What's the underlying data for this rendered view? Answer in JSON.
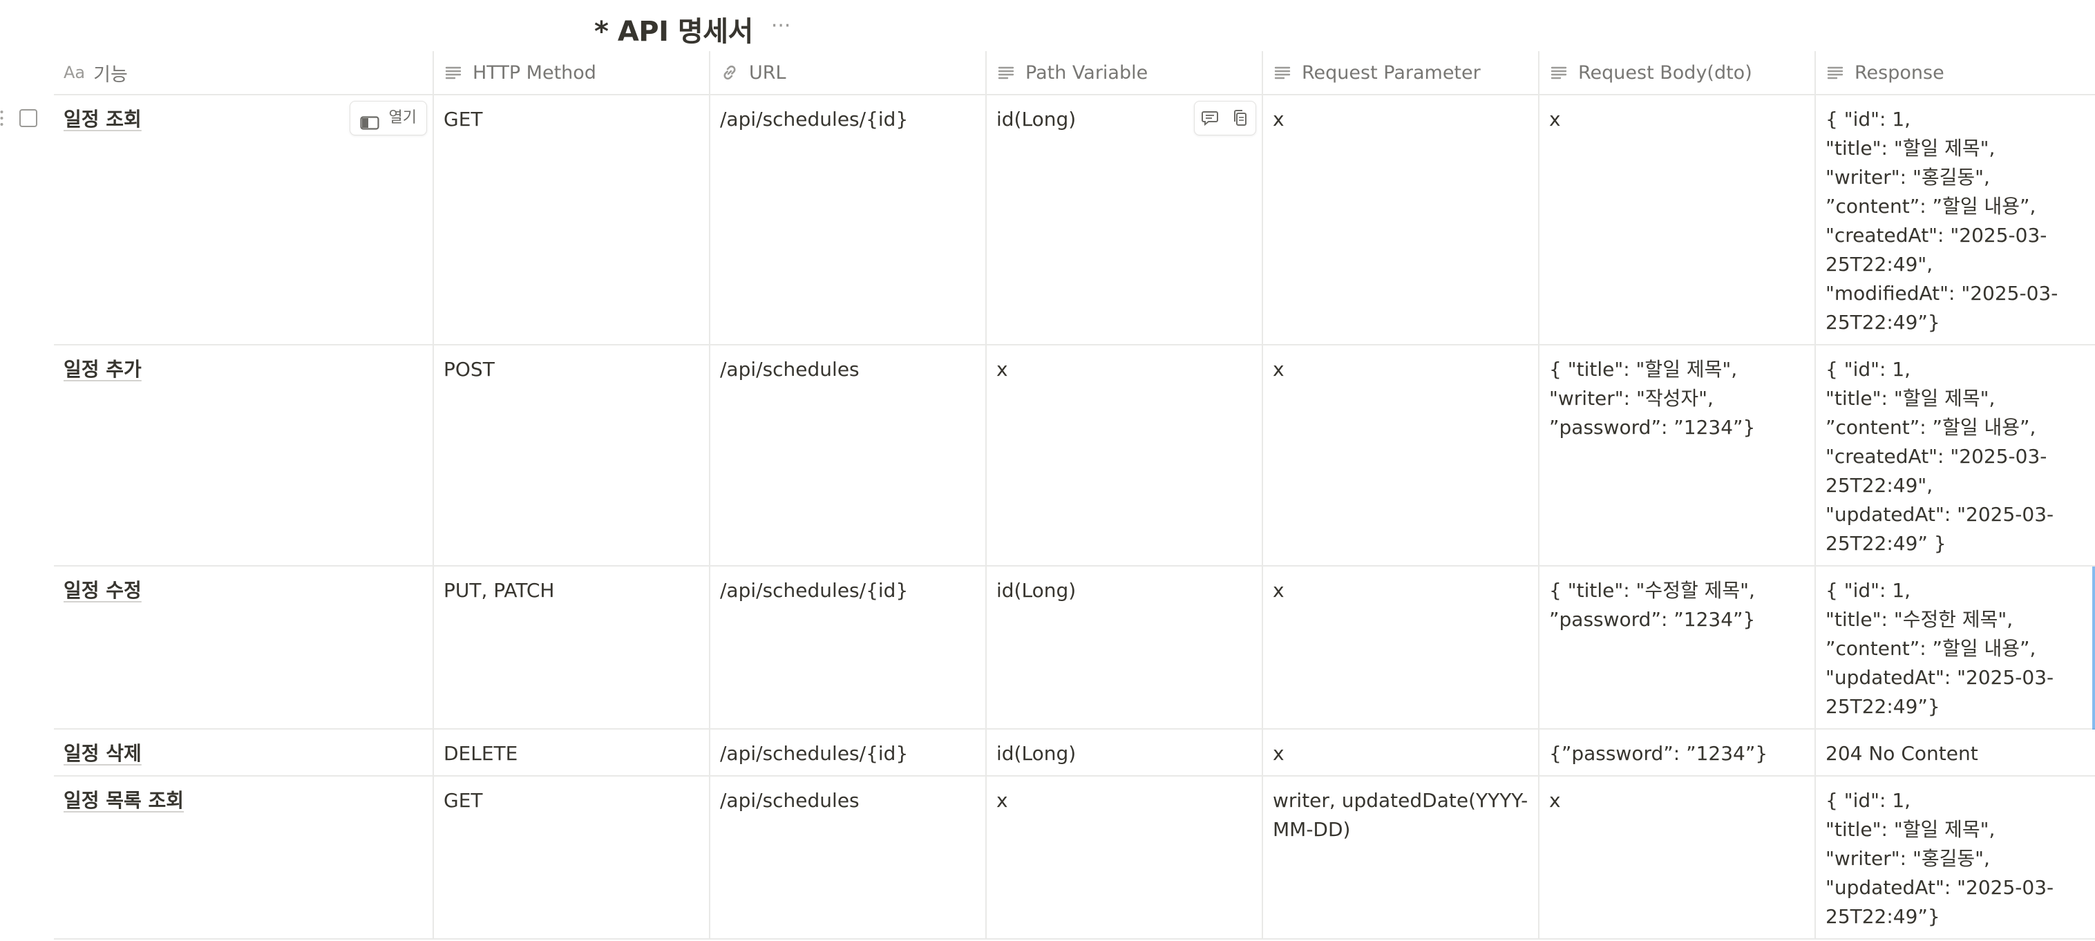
{
  "page": {
    "title": "* API 명세서",
    "more_label": "···"
  },
  "columns": [
    {
      "label": "기능",
      "icon": "aa-title-icon",
      "icon_text": "Aa"
    },
    {
      "label": "HTTP Method",
      "icon": "text-lines-icon"
    },
    {
      "label": "URL",
      "icon": "link-icon"
    },
    {
      "label": "Path Variable",
      "icon": "text-lines-icon"
    },
    {
      "label": "Request Parameter",
      "icon": "text-lines-icon"
    },
    {
      "label": "Request Body(dto)",
      "icon": "text-lines-icon"
    },
    {
      "label": "Response",
      "icon": "text-lines-icon"
    }
  ],
  "row_hover": {
    "open_label": "열기"
  },
  "rows": [
    {
      "name": "일정 조회",
      "method": "GET",
      "url": "/api/schedules/{id}",
      "path_variable": "id(Long)",
      "request_parameter": "x",
      "request_body": "x",
      "response": "{ \"id\": 1,\n\"title\": \"할일 제목\",\n\"writer\": \"홍길동\",\n”content”: ”할일 내용”,\n\"createdAt\": \"2025-03-25T22:49\",\n\"modifiedAt\": \"2025-03-25T22:49”}"
    },
    {
      "name": "일정 추가",
      "method": "POST",
      "url": "/api/schedules",
      "path_variable": "x",
      "request_parameter": "x",
      "request_body": "{ \"title\": \"할일 제목\",\n\"writer\": \"작성자\",\n”password”: ”1234”}",
      "response": "{ \"id\": 1,\n\"title\": \"할일 제목\",\n”content”: ”할일 내용”,\n\"createdAt\": \"2025-03-25T22:49\",\n\"updatedAt\": \"2025-03-25T22:49” }"
    },
    {
      "name": "일정 수정",
      "method": "PUT, PATCH",
      "url": "/api/schedules/{id}",
      "path_variable": "id(Long)",
      "request_parameter": "x",
      "request_body": "{ \"title\": \"수정할 제목\",\n”password”: ”1234”}",
      "response": "{ \"id\": 1,\n\"title\": \"수정한 제목\",\n”content”: ”할일 내용”,\n\"updatedAt\": \"2025-03-25T22:49”}"
    },
    {
      "name": "일정 삭제",
      "method": "DELETE",
      "url": "/api/schedules/{id}",
      "path_variable": "id(Long)",
      "request_parameter": "x",
      "request_body": "{”password”: ”1234”}",
      "response": "204 No Content"
    },
    {
      "name": "일정 목록 조회",
      "method": "GET",
      "url": "/api/schedules",
      "path_variable": "x",
      "request_parameter": "writer, updatedDate(YYYY-MM-DD)",
      "request_body": "x",
      "response": "{ \"id\": 1,\n\"title\": \"할일 제목\",\n\"writer\": \"홍길동\",\n\"updatedAt\": \"2025-03-25T22:49”}"
    }
  ]
}
